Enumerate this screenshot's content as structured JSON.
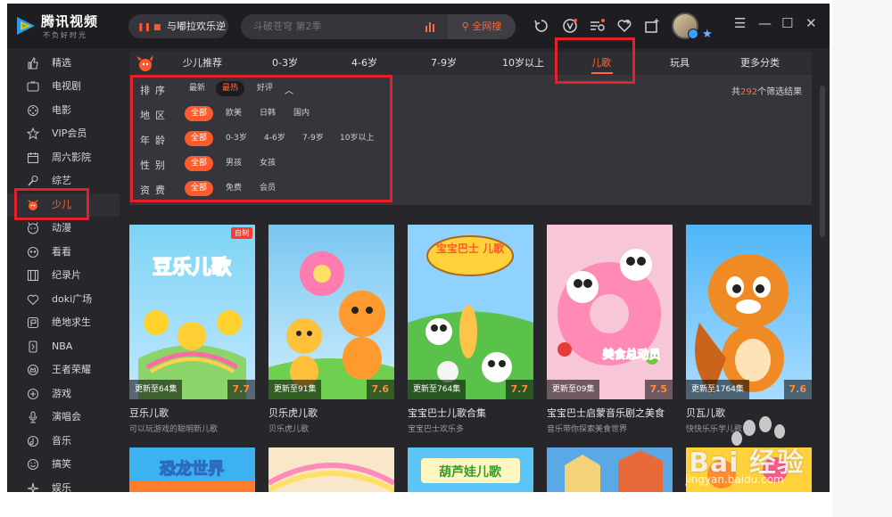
{
  "app": {
    "brand": "腾讯视频",
    "slogan": "不负好时光",
    "now_playing": "与嘟拉欢乐逆",
    "search_placeholder": "斗破苍穹 第2季",
    "search_button": "全网搜"
  },
  "sidebar": {
    "items": [
      {
        "label": "精选",
        "icon": "thumb-up-icon"
      },
      {
        "label": "电视剧",
        "icon": "tv-icon"
      },
      {
        "label": "电影",
        "icon": "film-reel-icon"
      },
      {
        "label": "VIP会员",
        "icon": "vip-star-icon"
      },
      {
        "label": "周六影院",
        "icon": "calendar-icon"
      },
      {
        "label": "综艺",
        "icon": "microphone-icon"
      },
      {
        "label": "少儿",
        "icon": "kids-icon"
      },
      {
        "label": "动漫",
        "icon": "anime-icon"
      },
      {
        "label": "看看",
        "icon": "eye-icon"
      },
      {
        "label": "纪录片",
        "icon": "filmstrip-icon"
      },
      {
        "label": "doki广场",
        "icon": "heart-icon"
      },
      {
        "label": "绝地求生",
        "icon": "flag-icon"
      },
      {
        "label": "NBA",
        "icon": "nba-icon"
      },
      {
        "label": "王者荣耀",
        "icon": "crown-icon"
      },
      {
        "label": "游戏",
        "icon": "gamepad-icon"
      },
      {
        "label": "演唱会",
        "icon": "mic-stand-icon"
      },
      {
        "label": "音乐",
        "icon": "music-icon"
      },
      {
        "label": "搞笑",
        "icon": "smile-icon"
      },
      {
        "label": "娱乐",
        "icon": "sparkle-icon"
      }
    ],
    "active_index": 6
  },
  "tabs": {
    "items": [
      "少儿推荐",
      "0-3岁",
      "4-6岁",
      "7-9岁",
      "10岁以上",
      "儿歌",
      "玩具",
      "更多分类"
    ],
    "active_index": 5
  },
  "filters": {
    "sort": {
      "label": "排序",
      "options": [
        "最新",
        "最热",
        "好评"
      ],
      "selected": 1
    },
    "region": {
      "label": "地区",
      "options": [
        "全部",
        "欧美",
        "日韩",
        "国内"
      ],
      "selected": 0
    },
    "age": {
      "label": "年龄",
      "options": [
        "全部",
        "0-3岁",
        "4-6岁",
        "7-9岁",
        "10岁以上"
      ],
      "selected": 0
    },
    "gender": {
      "label": "性别",
      "options": [
        "全部",
        "男孩",
        "女孩"
      ],
      "selected": 0
    },
    "fee": {
      "label": "资费",
      "options": [
        "全部",
        "免费",
        "会员"
      ],
      "selected": 0
    },
    "result_prefix": "共",
    "result_count": "292",
    "result_suffix": "个筛选结果"
  },
  "cards": [
    {
      "title": "豆乐儿歌",
      "subtitle": "可以玩游戏的聪明新儿歌",
      "episode": "更新至64集",
      "score": "7.7",
      "badge": "自制",
      "poster_text": "豆乐儿歌"
    },
    {
      "title": "贝乐虎儿歌",
      "subtitle": "贝乐虎儿歌",
      "episode": "更新至91集",
      "score": "7.6",
      "badge": "",
      "poster_text": ""
    },
    {
      "title": "宝宝巴士儿歌合集",
      "subtitle": "宝宝巴士欢乐多",
      "episode": "更新至764集",
      "score": "7.7",
      "badge": "",
      "poster_text": "宝宝巴士 儿歌"
    },
    {
      "title": "宝宝巴士启蒙音乐剧之美食",
      "subtitle": "音乐带你探索美食世界",
      "episode": "更新至09集",
      "score": "7.5",
      "badge": "",
      "poster_text": "美食总动员"
    },
    {
      "title": "贝瓦儿歌",
      "subtitle": "快快乐乐学儿歌",
      "episode": "更新至1764集",
      "score": "7.6",
      "badge": "",
      "poster_text": ""
    }
  ],
  "row2_posters": [
    "恐龙世界",
    "",
    "葫芦娃儿歌",
    "",
    ""
  ],
  "watermark": {
    "text": "Bai 经验",
    "url": "jingyan.baidu.com"
  },
  "colors": {
    "accent": "#ff6a3c",
    "highlight_box": "#e4212b",
    "bg": "#26262b"
  }
}
